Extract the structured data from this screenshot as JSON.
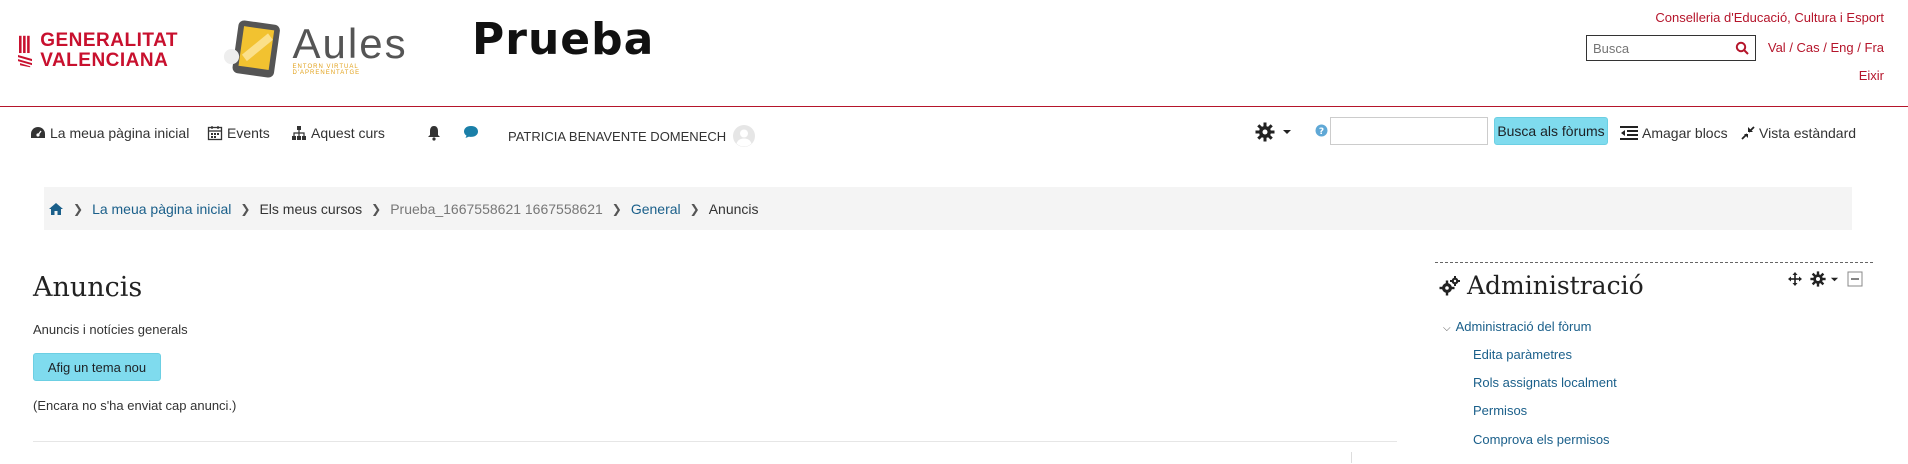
{
  "header": {
    "gva_logo_lines": [
      "GENERALITAT",
      "VALENCIANA"
    ],
    "aules_name": "Aules",
    "aules_tagline": "ENTORN VIRTUAL D'APRENENTATGE",
    "site_name": "Prueba",
    "conselleria": "Conselleria d'Educació, Cultura i Esport",
    "search_placeholder": "Busca",
    "languages": [
      "Val",
      "Cas",
      "Eng",
      "Fra"
    ],
    "lang_separator": " / ",
    "logout": "Eixir"
  },
  "nav": {
    "home": "La meua pàgina inicial",
    "events": "Events",
    "course": "Aquest curs",
    "user_name": "PATRICIA BENAVENTE DOMENECH",
    "forum_search_value": "",
    "search_forums_button": "Busca als fòrums",
    "hide_blocks": "Amagar blocs",
    "standard_view": "Vista estàndard"
  },
  "breadcrumb": {
    "items": [
      "La meua pàgina inicial",
      "Els meus cursos",
      "Prueba_1667558621 1667558621",
      "General",
      "Anuncis"
    ]
  },
  "main": {
    "title": "Anuncis",
    "subtitle": "Anuncis i notícies generals",
    "add_button": "Afig un tema nou",
    "empty_message": "(Encara no s'ha enviat cap anunci.)"
  },
  "admin_block": {
    "title": "Administració",
    "section": "Administració del fòrum",
    "items": [
      "Edita paràmetres",
      "Rols assignats localment",
      "Permisos",
      "Comprova els permisos"
    ]
  },
  "colors": {
    "brand_red": "#b5152b",
    "link_blue": "#1a5f8a",
    "button_cyan": "#7fdbee",
    "breadcrumb_bg": "#f4f4f4"
  }
}
